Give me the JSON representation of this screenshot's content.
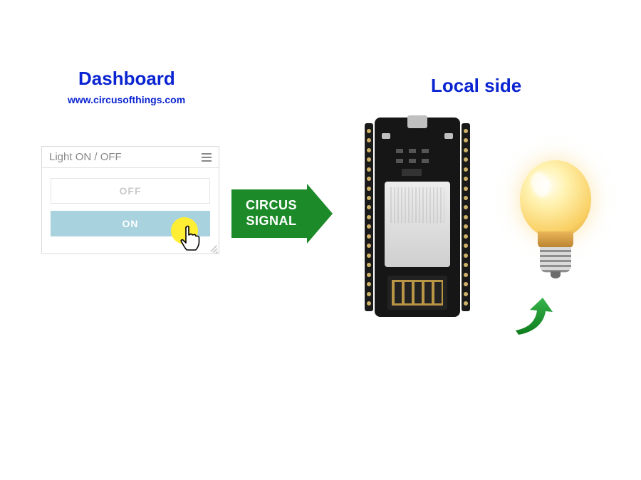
{
  "headings": {
    "dashboard": "Dashboard",
    "url": "www.circusofthings.com",
    "local_side": "Local side"
  },
  "widget": {
    "title": "Light ON / OFF",
    "off_label": "OFF",
    "on_label": "ON"
  },
  "signal": {
    "line1": "CIRCUS",
    "line2": "SIGNAL"
  }
}
